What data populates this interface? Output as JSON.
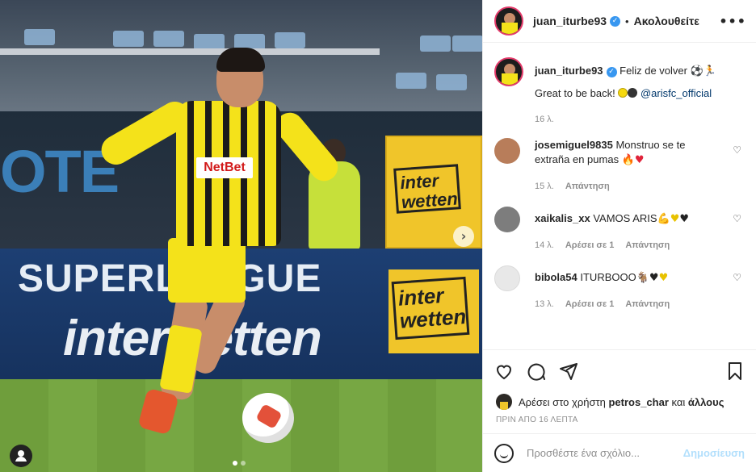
{
  "post": {
    "username": "juan_iturbe93",
    "verified_mark": "✓",
    "bullet": "•",
    "follow_label": "Ακολουθείτε",
    "more_label": "•••",
    "caption_line1": "Feliz de volver ⚽🏃",
    "caption_line2": "Great to be back!",
    "caption_mention": "@arisfc_official",
    "caption_time": "16 λ."
  },
  "photo": {
    "jersey_sponsor": "NetBet",
    "board_left_text": "OTE",
    "board_league": "SUPERLEAGUE",
    "board_sponsor": "interwetten",
    "board_box_text": "inter wetten",
    "next_arrow": "›",
    "tag_icon": "person-icon"
  },
  "comments": [
    {
      "username": "josemiguel9835",
      "text": "Monstruo se te extraña en pumas",
      "emoji": "🔥♥",
      "time": "15 λ.",
      "likes": "",
      "reply": "Απάντηση"
    },
    {
      "username": "xaikalis_xx",
      "text": "VAMOS ARIS",
      "emoji": "💪",
      "time": "14 λ.",
      "likes": "Αρέσει σε 1",
      "reply": "Απάντηση"
    },
    {
      "username": "bibola54",
      "text": "ITURBOOO",
      "emoji": "🐐",
      "time": "13 λ.",
      "likes": "Αρέσει σε 1",
      "reply": "Απάντηση"
    }
  ],
  "likes_line": {
    "prefix": "Αρέσει στο χρήστη",
    "user": "petros_char",
    "suffix": "και",
    "others": "άλλους"
  },
  "timestamp": "ΠΡΙΝ ΑΠΟ 16 ΛΕΠΤΑ",
  "add_comment": {
    "placeholder": "Προσθέστε ένα σχόλιο...",
    "post_label": "Δημοσίευση"
  },
  "colors": {
    "club_yellow": "#f4e21a",
    "verified_blue": "#3897f0",
    "post_disabled": "#b2dffc"
  }
}
